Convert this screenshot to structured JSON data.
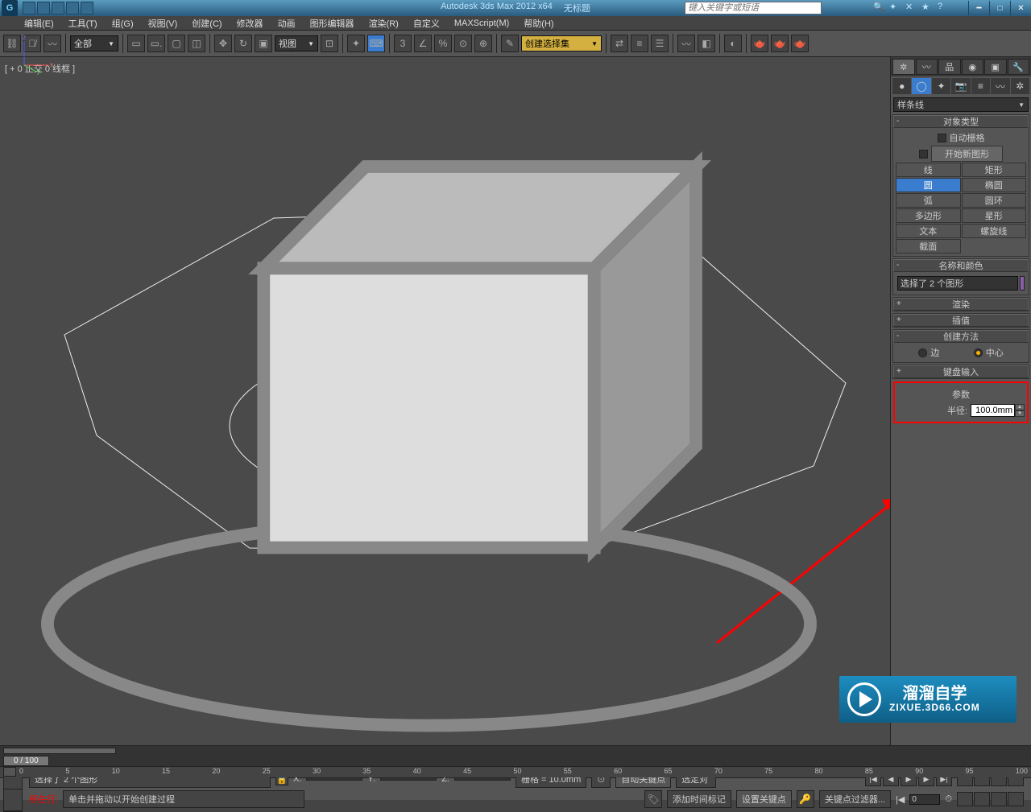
{
  "titlebar": {
    "app": "Autodesk 3ds Max  2012 x64",
    "doc": "无标题",
    "search_placeholder": "键入关键字或短语"
  },
  "menu": [
    "编辑(E)",
    "工具(T)",
    "组(G)",
    "视图(V)",
    "创建(C)",
    "修改器",
    "动画",
    "图形编辑器",
    "渲染(R)",
    "自定义",
    "MAXScript(M)",
    "帮助(H)"
  ],
  "toolbar": {
    "filter": "全部",
    "coord": "视图",
    "named_set": "创建选择集"
  },
  "viewport": {
    "label": "[ + 0  正交 0  线框  ]"
  },
  "panel": {
    "category": "样条线",
    "rollouts": {
      "object_type": {
        "title": "对象类型",
        "autogrid": "自动栅格",
        "start_new": "开始新图形",
        "buttons": [
          [
            "线",
            "矩形"
          ],
          [
            "圆",
            "椭圆"
          ],
          [
            "弧",
            "圆环"
          ],
          [
            "多边形",
            "星形"
          ],
          [
            "文本",
            "螺旋线"
          ],
          [
            "截面",
            ""
          ]
        ]
      },
      "name_color": {
        "title": "名称和颜色",
        "value": "选择了 2 个图形"
      },
      "rendering": {
        "title": "渲染"
      },
      "interpolation": {
        "title": "插值"
      },
      "creation": {
        "title": "创建方法",
        "edge": "边",
        "center": "中心"
      },
      "keyboard": {
        "title": "键盘输入"
      },
      "params": {
        "title": "参数",
        "radius_label": "半径:",
        "radius_value": "100.0mm"
      }
    }
  },
  "timeline": {
    "slider": "0 / 100",
    "ticks": [
      "0",
      "5",
      "10",
      "15",
      "20",
      "25",
      "30",
      "35",
      "40",
      "45",
      "50",
      "55",
      "60",
      "65",
      "70",
      "75",
      "80",
      "85",
      "90",
      "95",
      "100"
    ]
  },
  "status": {
    "selection": "选择了 2 个图形",
    "prompt": "单击并拖动以开始创建过程",
    "grid": "栅格 = 10.0mm",
    "autokey": "自动关键点",
    "selected": "选定对",
    "setkey": "设置关键点",
    "keyfilter": "关键点过滤器...",
    "addtag": "添加时间标记",
    "where": "所在行:",
    "spin_val": "0"
  },
  "watermark": {
    "brand": "溜溜自学",
    "url": "ZIXUE.3D66.COM"
  }
}
